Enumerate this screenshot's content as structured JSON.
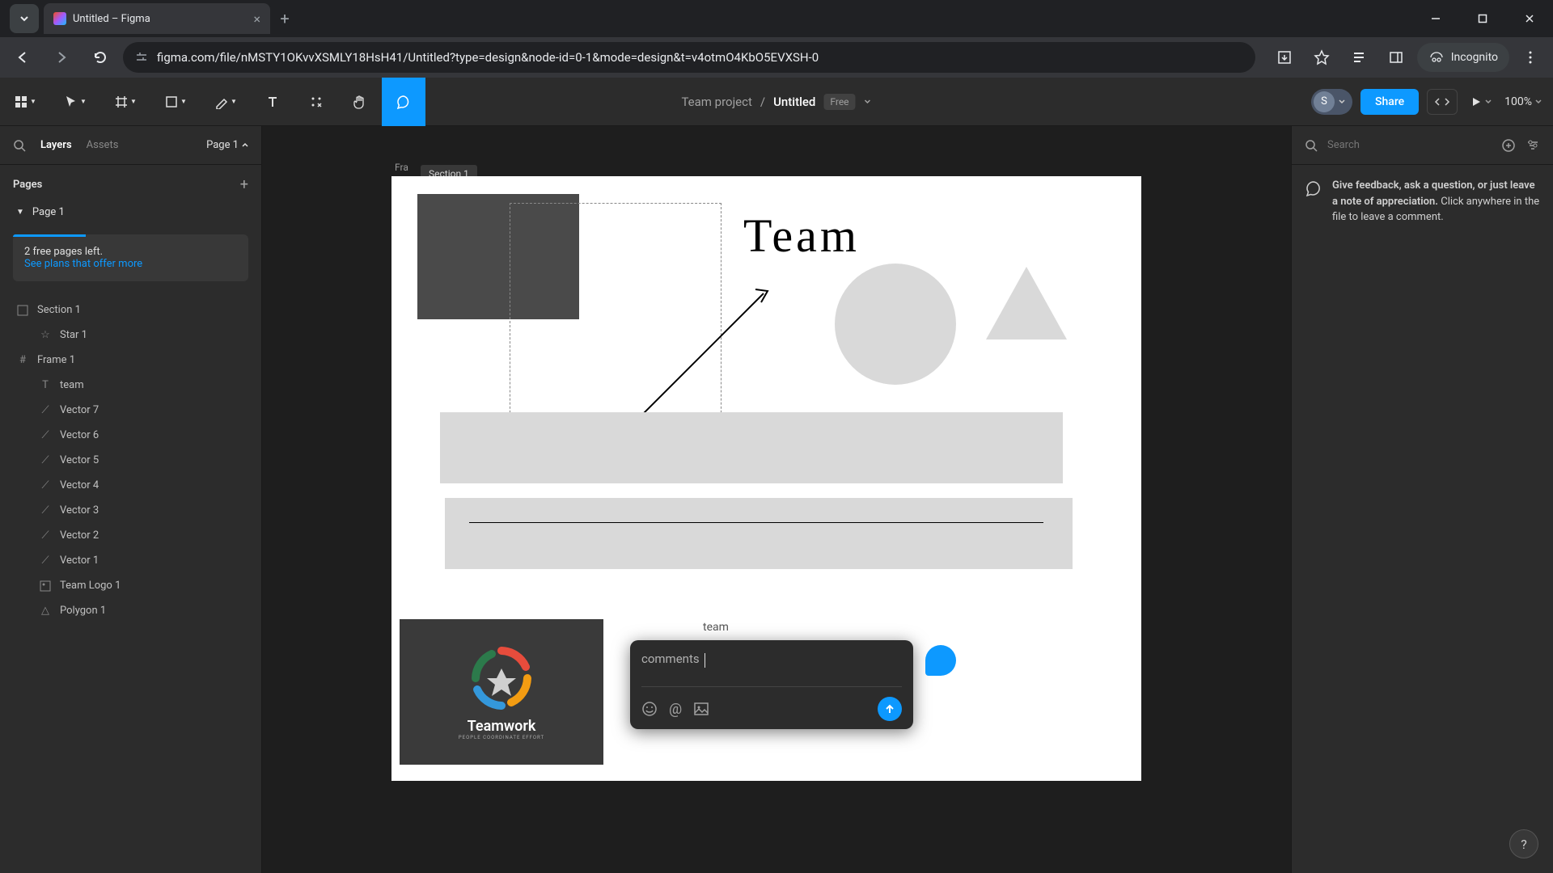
{
  "browser": {
    "tab_title": "Untitled – Figma",
    "url": "figma.com/file/nMSTY1OKvvXSMLY18HsH41/Untitled?type=design&node-id=0-1&mode=design&t=v4otmO4KbO5EVXSH-0",
    "incognito_label": "Incognito"
  },
  "figma": {
    "project": "Team project",
    "file": "Untitled",
    "plan_badge": "Free",
    "share_label": "Share",
    "zoom": "100%",
    "user_initial": "S"
  },
  "left_panel": {
    "tab_layers": "Layers",
    "tab_assets": "Assets",
    "page_selector": "Page 1",
    "pages_title": "Pages",
    "page_list": [
      {
        "name": "Page 1"
      }
    ],
    "promo_line1": "2 free pages left.",
    "promo_link": "See plans that offer more",
    "layers": [
      {
        "name": "Section 1",
        "icon": "section",
        "depth": 0
      },
      {
        "name": "Star 1",
        "icon": "star",
        "depth": 1
      },
      {
        "name": "Frame 1",
        "icon": "frame",
        "depth": 0
      },
      {
        "name": "team",
        "icon": "text",
        "depth": 1
      },
      {
        "name": "Vector 7",
        "icon": "vector",
        "depth": 1
      },
      {
        "name": "Vector 6",
        "icon": "vector",
        "depth": 1
      },
      {
        "name": "Vector 5",
        "icon": "vector",
        "depth": 1
      },
      {
        "name": "Vector 4",
        "icon": "vector",
        "depth": 1
      },
      {
        "name": "Vector 3",
        "icon": "vector",
        "depth": 1
      },
      {
        "name": "Vector 2",
        "icon": "vector",
        "depth": 1
      },
      {
        "name": "Vector 1",
        "icon": "vector",
        "depth": 1
      },
      {
        "name": "Team Logo 1",
        "icon": "image",
        "depth": 1
      },
      {
        "name": "Polygon 1",
        "icon": "polygon",
        "depth": 1
      }
    ]
  },
  "canvas": {
    "frame_label": "Fra",
    "section_tab": "Section 1",
    "hand_text": "Team",
    "small_label": "team",
    "logo_text": "Teamwork",
    "logo_sub": "PEOPLE COORDINATE EFFORT",
    "comment_text": "comments"
  },
  "right_panel": {
    "search_placeholder": "Search",
    "hint": "Click anywhere in the file to leave a comment.",
    "hint_strong": "Give feedback, ask a question, or just leave a note of appreciation."
  },
  "help": "?"
}
